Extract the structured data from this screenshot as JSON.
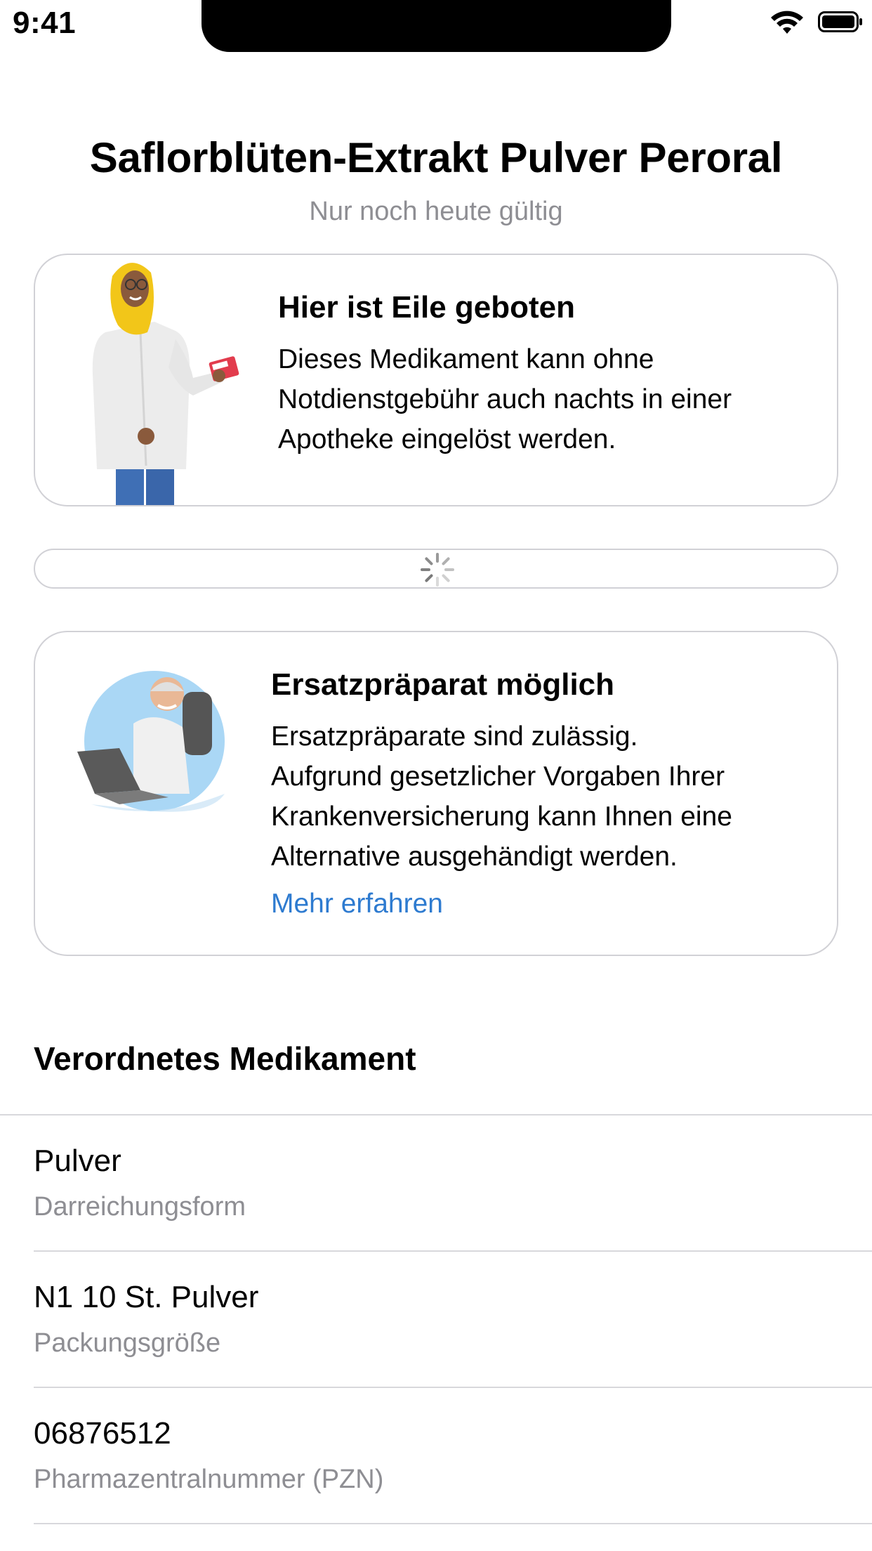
{
  "status_bar": {
    "time": "9:41",
    "icons": [
      "wifi-icon",
      "battery-icon"
    ]
  },
  "header": {
    "title": "Saflorblüten-Extrakt Pulver Peroral",
    "subtitle": "Nur noch heute gültig"
  },
  "urgent_card": {
    "illustration": "pharmacist-illustration",
    "title": "Hier ist Eile geboten",
    "text_lines": [
      "Dieses Medikament kann ohne",
      "Notdienstgebühr auch nachts in einer",
      "Apotheke eingelöst werden."
    ]
  },
  "loading_card": {
    "icon": "spinner-icon"
  },
  "substitute_card": {
    "illustration": "doctor-illustration",
    "title": "Ersatzpräparat möglich",
    "text_lines": [
      "Ersatzpräparate sind zulässig.",
      "Aufgrund gesetzlicher Vorgaben Ihrer",
      "Krankenversicherung kann Ihnen eine",
      "Alternative ausgehändigt werden."
    ],
    "link_label": "Mehr erfahren"
  },
  "prescribed": {
    "heading": "Verordnetes Medikament",
    "rows": [
      {
        "value": "Pulver",
        "label": "Darreichungsform"
      },
      {
        "value": "N1 10 St. Pulver",
        "label": "Packungsgröße"
      },
      {
        "value": "06876512",
        "label": "Pharmazentralnummer (PZN)"
      }
    ]
  },
  "colors": {
    "link": "#2e7bd0",
    "secondary_text": "#8e8e93",
    "card_border": "#d1d1d6"
  }
}
